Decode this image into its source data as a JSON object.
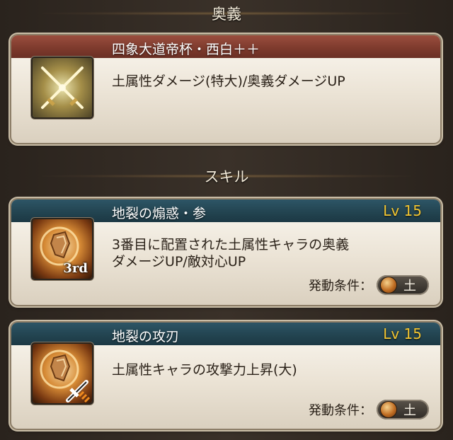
{
  "ougi_section": {
    "title": "奥義"
  },
  "ougi_card": {
    "name": "四象大道帝杯・西白＋＋",
    "description": "土属性ダメージ(特大)/奥義ダメージUP"
  },
  "skill_section": {
    "title": "スキル"
  },
  "skills": [
    {
      "name": "地裂の煽惑・参",
      "level": "Lv 15",
      "description_lines": [
        "3番目に配置された土属性キャラの奥義",
        "ダメージUP/敵対心UP"
      ],
      "badge": "3rd",
      "trigger_label": "発動条件：",
      "element": "土"
    },
    {
      "name": "地裂の攻刃",
      "level": "Lv 15",
      "description_lines": [
        "土属性キャラの攻撃力上昇(大)"
      ],
      "trigger_label": "発動条件：",
      "element": "土"
    }
  ],
  "colors": {
    "ougi_header": "#7c392c",
    "skill_header": "#22434f",
    "level_text": "#f2c531",
    "earth_orb": "#c06d22"
  },
  "icons": {
    "ougi": "crossed-swords-icon",
    "skill_1": "earth-rock-icon",
    "skill_2": "earth-rock-sword-icon"
  }
}
